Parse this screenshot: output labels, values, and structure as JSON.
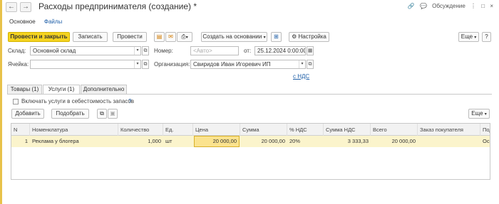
{
  "window": {
    "title": "Расходы предпринимателя (создание) *",
    "discussion_label": "Обсуждение",
    "more_icon": "⋮",
    "close_icon": "×",
    "maximize_icon": "□",
    "link_icon": "🔗"
  },
  "top_tabs": [
    "Основное",
    "Файлы"
  ],
  "toolbar": {
    "post_close": "Провести и закрыть",
    "save": "Записать",
    "post": "Провести",
    "create_based": "Создать на основании",
    "settings": "Настройка",
    "more": "Еще"
  },
  "form": {
    "warehouse_label": "Склад:",
    "warehouse_value": "Основной склад",
    "cell_label": "Ячейка:",
    "cell_value": "",
    "number_label": "Номер:",
    "number_placeholder": "<Авто>",
    "date_prefix": "от:",
    "date_value": "25.12.2024  0:00:00",
    "org_label": "Организация:",
    "org_value": "Свиридов Иван Игоревич ИП",
    "vat_link": "с НДС"
  },
  "tabs": [
    "Товары (1)",
    "Услуги (1)",
    "Дополнительно"
  ],
  "services": {
    "include_cost_label": "Включать услуги в себестоимость запасов",
    "help": "?",
    "add_button": "Добавить",
    "pick_button": "Подобрать",
    "more": "Еще"
  },
  "table": {
    "headers": [
      "N",
      "Номенклатура",
      "Количество",
      "Ед.",
      "Цена",
      "Сумма",
      "% НДС",
      "Сумма НДС",
      "Всего",
      "Заказ покупателя",
      "Под"
    ],
    "rows": [
      [
        "1",
        "Реклама у блогера",
        "1,000",
        "шт",
        "20 000,00",
        "20 000,00",
        "20%",
        "3 333,33",
        "20 000,00",
        "",
        "Осн"
      ]
    ]
  }
}
